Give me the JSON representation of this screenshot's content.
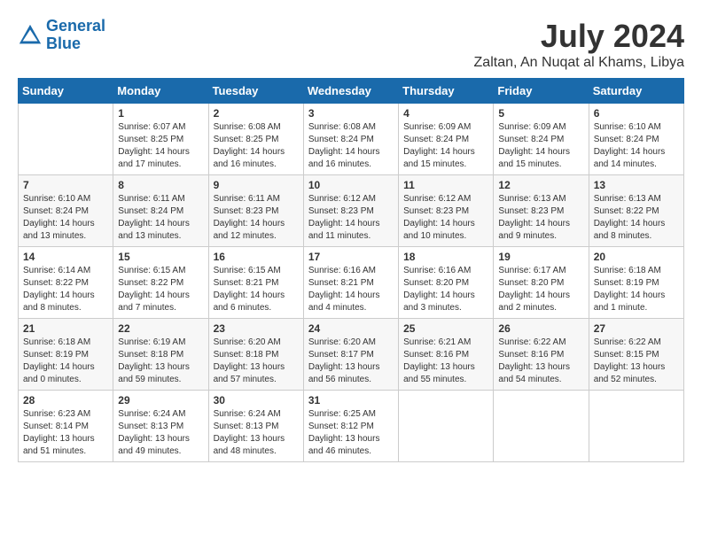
{
  "logo": {
    "line1": "General",
    "line2": "Blue"
  },
  "title": "July 2024",
  "location": "Zaltan, An Nuqat al Khams, Libya",
  "weekdays": [
    "Sunday",
    "Monday",
    "Tuesday",
    "Wednesday",
    "Thursday",
    "Friday",
    "Saturday"
  ],
  "weeks": [
    [
      {
        "day": "",
        "sunrise": "",
        "sunset": "",
        "daylight": ""
      },
      {
        "day": "1",
        "sunrise": "Sunrise: 6:07 AM",
        "sunset": "Sunset: 8:25 PM",
        "daylight": "Daylight: 14 hours and 17 minutes."
      },
      {
        "day": "2",
        "sunrise": "Sunrise: 6:08 AM",
        "sunset": "Sunset: 8:25 PM",
        "daylight": "Daylight: 14 hours and 16 minutes."
      },
      {
        "day": "3",
        "sunrise": "Sunrise: 6:08 AM",
        "sunset": "Sunset: 8:24 PM",
        "daylight": "Daylight: 14 hours and 16 minutes."
      },
      {
        "day": "4",
        "sunrise": "Sunrise: 6:09 AM",
        "sunset": "Sunset: 8:24 PM",
        "daylight": "Daylight: 14 hours and 15 minutes."
      },
      {
        "day": "5",
        "sunrise": "Sunrise: 6:09 AM",
        "sunset": "Sunset: 8:24 PM",
        "daylight": "Daylight: 14 hours and 15 minutes."
      },
      {
        "day": "6",
        "sunrise": "Sunrise: 6:10 AM",
        "sunset": "Sunset: 8:24 PM",
        "daylight": "Daylight: 14 hours and 14 minutes."
      }
    ],
    [
      {
        "day": "7",
        "sunrise": "Sunrise: 6:10 AM",
        "sunset": "Sunset: 8:24 PM",
        "daylight": "Daylight: 14 hours and 13 minutes."
      },
      {
        "day": "8",
        "sunrise": "Sunrise: 6:11 AM",
        "sunset": "Sunset: 8:24 PM",
        "daylight": "Daylight: 14 hours and 13 minutes."
      },
      {
        "day": "9",
        "sunrise": "Sunrise: 6:11 AM",
        "sunset": "Sunset: 8:23 PM",
        "daylight": "Daylight: 14 hours and 12 minutes."
      },
      {
        "day": "10",
        "sunrise": "Sunrise: 6:12 AM",
        "sunset": "Sunset: 8:23 PM",
        "daylight": "Daylight: 14 hours and 11 minutes."
      },
      {
        "day": "11",
        "sunrise": "Sunrise: 6:12 AM",
        "sunset": "Sunset: 8:23 PM",
        "daylight": "Daylight: 14 hours and 10 minutes."
      },
      {
        "day": "12",
        "sunrise": "Sunrise: 6:13 AM",
        "sunset": "Sunset: 8:23 PM",
        "daylight": "Daylight: 14 hours and 9 minutes."
      },
      {
        "day": "13",
        "sunrise": "Sunrise: 6:13 AM",
        "sunset": "Sunset: 8:22 PM",
        "daylight": "Daylight: 14 hours and 8 minutes."
      }
    ],
    [
      {
        "day": "14",
        "sunrise": "Sunrise: 6:14 AM",
        "sunset": "Sunset: 8:22 PM",
        "daylight": "Daylight: 14 hours and 8 minutes."
      },
      {
        "day": "15",
        "sunrise": "Sunrise: 6:15 AM",
        "sunset": "Sunset: 8:22 PM",
        "daylight": "Daylight: 14 hours and 7 minutes."
      },
      {
        "day": "16",
        "sunrise": "Sunrise: 6:15 AM",
        "sunset": "Sunset: 8:21 PM",
        "daylight": "Daylight: 14 hours and 6 minutes."
      },
      {
        "day": "17",
        "sunrise": "Sunrise: 6:16 AM",
        "sunset": "Sunset: 8:21 PM",
        "daylight": "Daylight: 14 hours and 4 minutes."
      },
      {
        "day": "18",
        "sunrise": "Sunrise: 6:16 AM",
        "sunset": "Sunset: 8:20 PM",
        "daylight": "Daylight: 14 hours and 3 minutes."
      },
      {
        "day": "19",
        "sunrise": "Sunrise: 6:17 AM",
        "sunset": "Sunset: 8:20 PM",
        "daylight": "Daylight: 14 hours and 2 minutes."
      },
      {
        "day": "20",
        "sunrise": "Sunrise: 6:18 AM",
        "sunset": "Sunset: 8:19 PM",
        "daylight": "Daylight: 14 hours and 1 minute."
      }
    ],
    [
      {
        "day": "21",
        "sunrise": "Sunrise: 6:18 AM",
        "sunset": "Sunset: 8:19 PM",
        "daylight": "Daylight: 14 hours and 0 minutes."
      },
      {
        "day": "22",
        "sunrise": "Sunrise: 6:19 AM",
        "sunset": "Sunset: 8:18 PM",
        "daylight": "Daylight: 13 hours and 59 minutes."
      },
      {
        "day": "23",
        "sunrise": "Sunrise: 6:20 AM",
        "sunset": "Sunset: 8:18 PM",
        "daylight": "Daylight: 13 hours and 57 minutes."
      },
      {
        "day": "24",
        "sunrise": "Sunrise: 6:20 AM",
        "sunset": "Sunset: 8:17 PM",
        "daylight": "Daylight: 13 hours and 56 minutes."
      },
      {
        "day": "25",
        "sunrise": "Sunrise: 6:21 AM",
        "sunset": "Sunset: 8:16 PM",
        "daylight": "Daylight: 13 hours and 55 minutes."
      },
      {
        "day": "26",
        "sunrise": "Sunrise: 6:22 AM",
        "sunset": "Sunset: 8:16 PM",
        "daylight": "Daylight: 13 hours and 54 minutes."
      },
      {
        "day": "27",
        "sunrise": "Sunrise: 6:22 AM",
        "sunset": "Sunset: 8:15 PM",
        "daylight": "Daylight: 13 hours and 52 minutes."
      }
    ],
    [
      {
        "day": "28",
        "sunrise": "Sunrise: 6:23 AM",
        "sunset": "Sunset: 8:14 PM",
        "daylight": "Daylight: 13 hours and 51 minutes."
      },
      {
        "day": "29",
        "sunrise": "Sunrise: 6:24 AM",
        "sunset": "Sunset: 8:13 PM",
        "daylight": "Daylight: 13 hours and 49 minutes."
      },
      {
        "day": "30",
        "sunrise": "Sunrise: 6:24 AM",
        "sunset": "Sunset: 8:13 PM",
        "daylight": "Daylight: 13 hours and 48 minutes."
      },
      {
        "day": "31",
        "sunrise": "Sunrise: 6:25 AM",
        "sunset": "Sunset: 8:12 PM",
        "daylight": "Daylight: 13 hours and 46 minutes."
      },
      {
        "day": "",
        "sunrise": "",
        "sunset": "",
        "daylight": ""
      },
      {
        "day": "",
        "sunrise": "",
        "sunset": "",
        "daylight": ""
      },
      {
        "day": "",
        "sunrise": "",
        "sunset": "",
        "daylight": ""
      }
    ]
  ]
}
